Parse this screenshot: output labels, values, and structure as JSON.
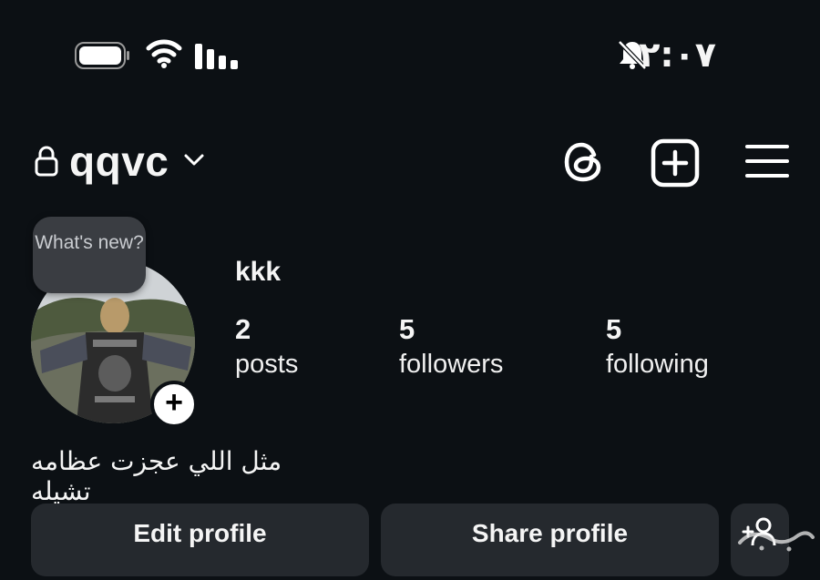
{
  "status_bar": {
    "time": "٢:٠٧",
    "icons": [
      "battery-icon",
      "wifi-icon",
      "signal-icon",
      "bell-muted-icon"
    ]
  },
  "header": {
    "username": "qqvc",
    "icons": [
      "lock-icon",
      "chevron-down-icon",
      "threads-icon",
      "new-post-icon",
      "menu-icon"
    ]
  },
  "profile": {
    "note_bubble": "What's new?",
    "display_name": "kkk",
    "stats": [
      {
        "value": "2",
        "label": "posts"
      },
      {
        "value": "5",
        "label": "followers"
      },
      {
        "value": "5",
        "label": "following"
      }
    ],
    "bio": "مثل اللي عجزت عظامه تشيله"
  },
  "actions": {
    "edit_label": "Edit profile",
    "share_label": "Share profile"
  },
  "colors": {
    "background": "#0c1014",
    "button": "#25292e",
    "text": "#f5f5f5"
  }
}
